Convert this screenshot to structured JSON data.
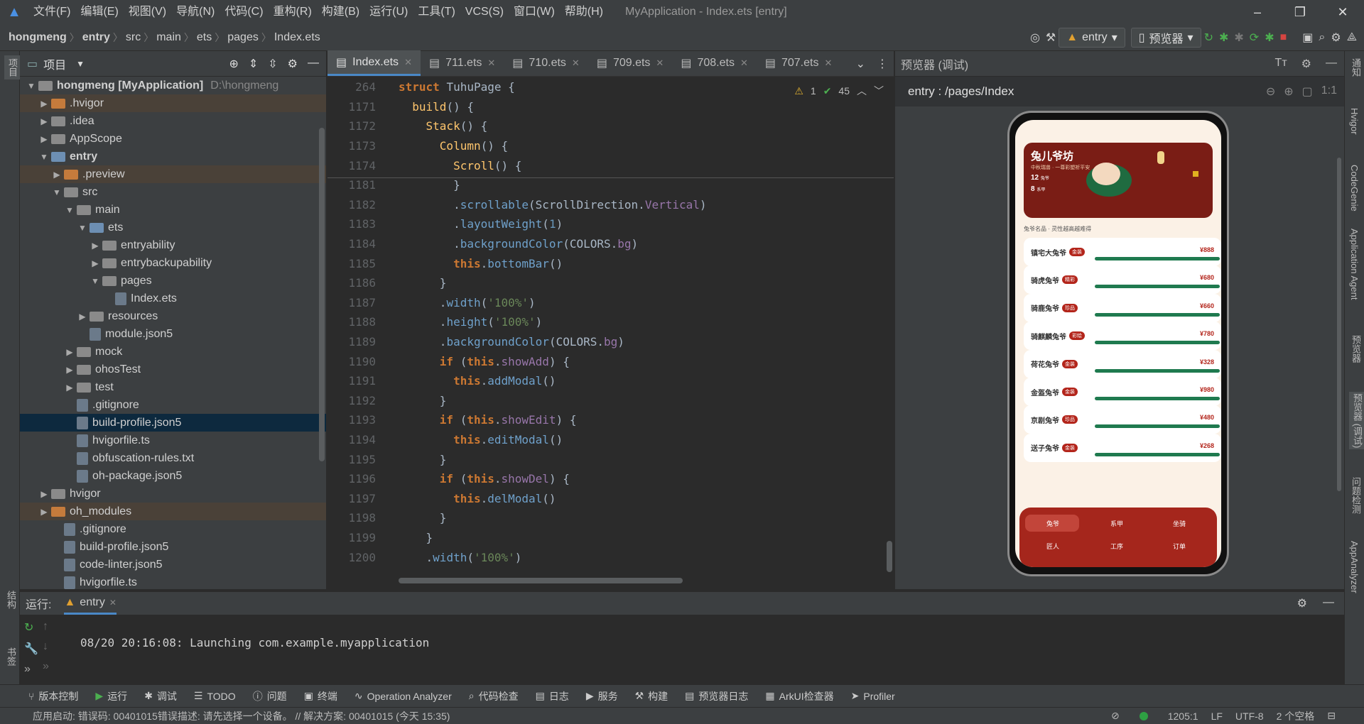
{
  "menu": [
    "文件(F)",
    "编辑(E)",
    "视图(V)",
    "导航(N)",
    "代码(C)",
    "重构(R)",
    "构建(B)",
    "运行(U)",
    "工具(T)",
    "VCS(S)",
    "窗口(W)",
    "帮助(H)"
  ],
  "window_title": "MyApplication - Index.ets [entry]",
  "breadcrumb": [
    "hongmeng",
    "entry",
    "src",
    "main",
    "ets",
    "pages",
    "Index.ets"
  ],
  "toolbar": {
    "run_config": "entry",
    "device": "预览器"
  },
  "project_panel": {
    "title": "项目",
    "root": "hongmeng [MyApplication]",
    "root_path": "D:\\hongmeng",
    "items": [
      {
        "label": ".hvigor",
        "indent": 1,
        "type": "folder-orange",
        "arrow": "▶"
      },
      {
        "label": ".idea",
        "indent": 1,
        "type": "folder-gray",
        "arrow": "▶"
      },
      {
        "label": "AppScope",
        "indent": 1,
        "type": "folder-gray",
        "arrow": "▶"
      },
      {
        "label": "entry",
        "indent": 1,
        "type": "folder-blue",
        "arrow": "▼",
        "bold": true
      },
      {
        "label": ".preview",
        "indent": 2,
        "type": "folder-orange",
        "arrow": "▶"
      },
      {
        "label": "src",
        "indent": 2,
        "type": "folder-gray",
        "arrow": "▼"
      },
      {
        "label": "main",
        "indent": 3,
        "type": "folder-gray",
        "arrow": "▼"
      },
      {
        "label": "ets",
        "indent": 4,
        "type": "folder-blue",
        "arrow": "▼"
      },
      {
        "label": "entryability",
        "indent": 5,
        "type": "folder-gray",
        "arrow": "▶"
      },
      {
        "label": "entrybackupability",
        "indent": 5,
        "type": "folder-gray",
        "arrow": "▶"
      },
      {
        "label": "pages",
        "indent": 5,
        "type": "folder-gray",
        "arrow": "▼"
      },
      {
        "label": "Index.ets",
        "indent": 6,
        "type": "file",
        "arrow": ""
      },
      {
        "label": "resources",
        "indent": 4,
        "type": "folder-gray",
        "arrow": "▶"
      },
      {
        "label": "module.json5",
        "indent": 4,
        "type": "file",
        "arrow": ""
      },
      {
        "label": "mock",
        "indent": 3,
        "type": "folder-gray",
        "arrow": "▶"
      },
      {
        "label": "ohosTest",
        "indent": 3,
        "type": "folder-gray",
        "arrow": "▶"
      },
      {
        "label": "test",
        "indent": 3,
        "type": "folder-gray",
        "arrow": "▶"
      },
      {
        "label": ".gitignore",
        "indent": 3,
        "type": "file",
        "arrow": ""
      },
      {
        "label": "build-profile.json5",
        "indent": 3,
        "type": "file",
        "arrow": "",
        "selected": true
      },
      {
        "label": "hvigorfile.ts",
        "indent": 3,
        "type": "file",
        "arrow": ""
      },
      {
        "label": "obfuscation-rules.txt",
        "indent": 3,
        "type": "file",
        "arrow": ""
      },
      {
        "label": "oh-package.json5",
        "indent": 3,
        "type": "file",
        "arrow": ""
      },
      {
        "label": "hvigor",
        "indent": 1,
        "type": "folder-gray",
        "arrow": "▶"
      },
      {
        "label": "oh_modules",
        "indent": 1,
        "type": "folder-orange",
        "arrow": "▶"
      },
      {
        "label": ".gitignore",
        "indent": 2,
        "type": "file",
        "arrow": ""
      },
      {
        "label": "build-profile.json5",
        "indent": 2,
        "type": "file",
        "arrow": ""
      },
      {
        "label": "code-linter.json5",
        "indent": 2,
        "type": "file",
        "arrow": ""
      },
      {
        "label": "hvigorfile.ts",
        "indent": 2,
        "type": "file",
        "arrow": ""
      }
    ]
  },
  "editor": {
    "tabs": [
      "Index.ets",
      "711.ets",
      "710.ets",
      "709.ets",
      "708.ets",
      "707.ets"
    ],
    "inspection": {
      "warnings": "1",
      "checks": "45"
    },
    "lines": [
      {
        "n": "264",
        "code": "struct TuhuPage {"
      },
      {
        "n": "1171",
        "code": "  build() {"
      },
      {
        "n": "1172",
        "code": "    Stack() {"
      },
      {
        "n": "1173",
        "code": "      Column() {"
      },
      {
        "n": "1174",
        "code": "        Scroll() {"
      },
      {
        "n": "1181",
        "code": "        }"
      },
      {
        "n": "1182",
        "code": "        .scrollable(ScrollDirection.Vertical)"
      },
      {
        "n": "1183",
        "code": "        .layoutWeight(1)"
      },
      {
        "n": "1184",
        "code": "        .backgroundColor(COLORS.bg)"
      },
      {
        "n": "1185",
        "code": "        this.bottomBar()"
      },
      {
        "n": "1186",
        "code": "      }"
      },
      {
        "n": "1187",
        "code": "      .width('100%')"
      },
      {
        "n": "1188",
        "code": "      .height('100%')"
      },
      {
        "n": "1189",
        "code": "      .backgroundColor(COLORS.bg)"
      },
      {
        "n": "1190",
        "code": "      if (this.showAdd) {"
      },
      {
        "n": "1191",
        "code": "        this.addModal()"
      },
      {
        "n": "1192",
        "code": "      }"
      },
      {
        "n": "1193",
        "code": "      if (this.showEdit) {"
      },
      {
        "n": "1194",
        "code": "        this.editModal()"
      },
      {
        "n": "1195",
        "code": "      }"
      },
      {
        "n": "1196",
        "code": "      if (this.showDel) {"
      },
      {
        "n": "1197",
        "code": "        this.delModal()"
      },
      {
        "n": "1198",
        "code": "      }"
      },
      {
        "n": "1199",
        "code": "    }"
      },
      {
        "n": "1200",
        "code": "    .width('100%')"
      }
    ]
  },
  "preview": {
    "title": "预览器 (调试)",
    "route": "entry : /pages/Index",
    "app": {
      "banner_title": "兔儿爷坊",
      "banner_sub": "中秋瑞兽 · 一尊彩塑祈平安",
      "stat1": "12",
      "stat1_label": "兔爷",
      "stat2": "8",
      "stat2_label": "系甲",
      "section": "兔爷名品 · 灵性越高越难得",
      "items": [
        {
          "name": "镇宅大兔爷",
          "tag": "金装",
          "price": "¥888"
        },
        {
          "name": "骑虎兔爷",
          "tag": "精彩",
          "price": "¥680"
        },
        {
          "name": "骑鹿兔爷",
          "tag": "珍品",
          "price": "¥660"
        },
        {
          "name": "骑麒麟兔爷",
          "tag": "彩绘",
          "price": "¥780"
        },
        {
          "name": "荷花兔爷",
          "tag": "金装",
          "price": "¥328"
        },
        {
          "name": "金盔兔爷",
          "tag": "金装",
          "price": "¥980"
        },
        {
          "name": "京剧兔爷",
          "tag": "珍品",
          "price": "¥480"
        },
        {
          "name": "送子兔爷",
          "tag": "金装",
          "price": "¥268"
        }
      ],
      "tabbar": [
        "兔爷",
        "系甲",
        "坐骑",
        "匠人",
        "工序",
        "订单"
      ]
    }
  },
  "run_panel": {
    "label": "运行:",
    "tab": "entry",
    "log": "08/20 20:16:08: Launching com.example.myapplication"
  },
  "bottom_tools": [
    "版本控制",
    "运行",
    "调试",
    "TODO",
    "问题",
    "终端",
    "Operation Analyzer",
    "代码检查",
    "日志",
    "服务",
    "构建",
    "预览器日志",
    "ArkUI检查器",
    "Profiler"
  ],
  "status": {
    "message": "应用启动: 错误码: 00401015错误描述: 请先选择一个设备。 // 解决方案: 00401015 (今天 15:35)",
    "position": "1205:1",
    "line_sep": "LF",
    "encoding": "UTF-8",
    "indent": "2 个空格"
  },
  "right_tools": [
    "通知",
    "Hvigor",
    "CodeGenie",
    "Application Agent",
    "预览器",
    "预览器 (调试)",
    "问题检测",
    "AppAnalyzer"
  ],
  "left_tools": [
    "项目",
    "结构",
    "书签"
  ]
}
